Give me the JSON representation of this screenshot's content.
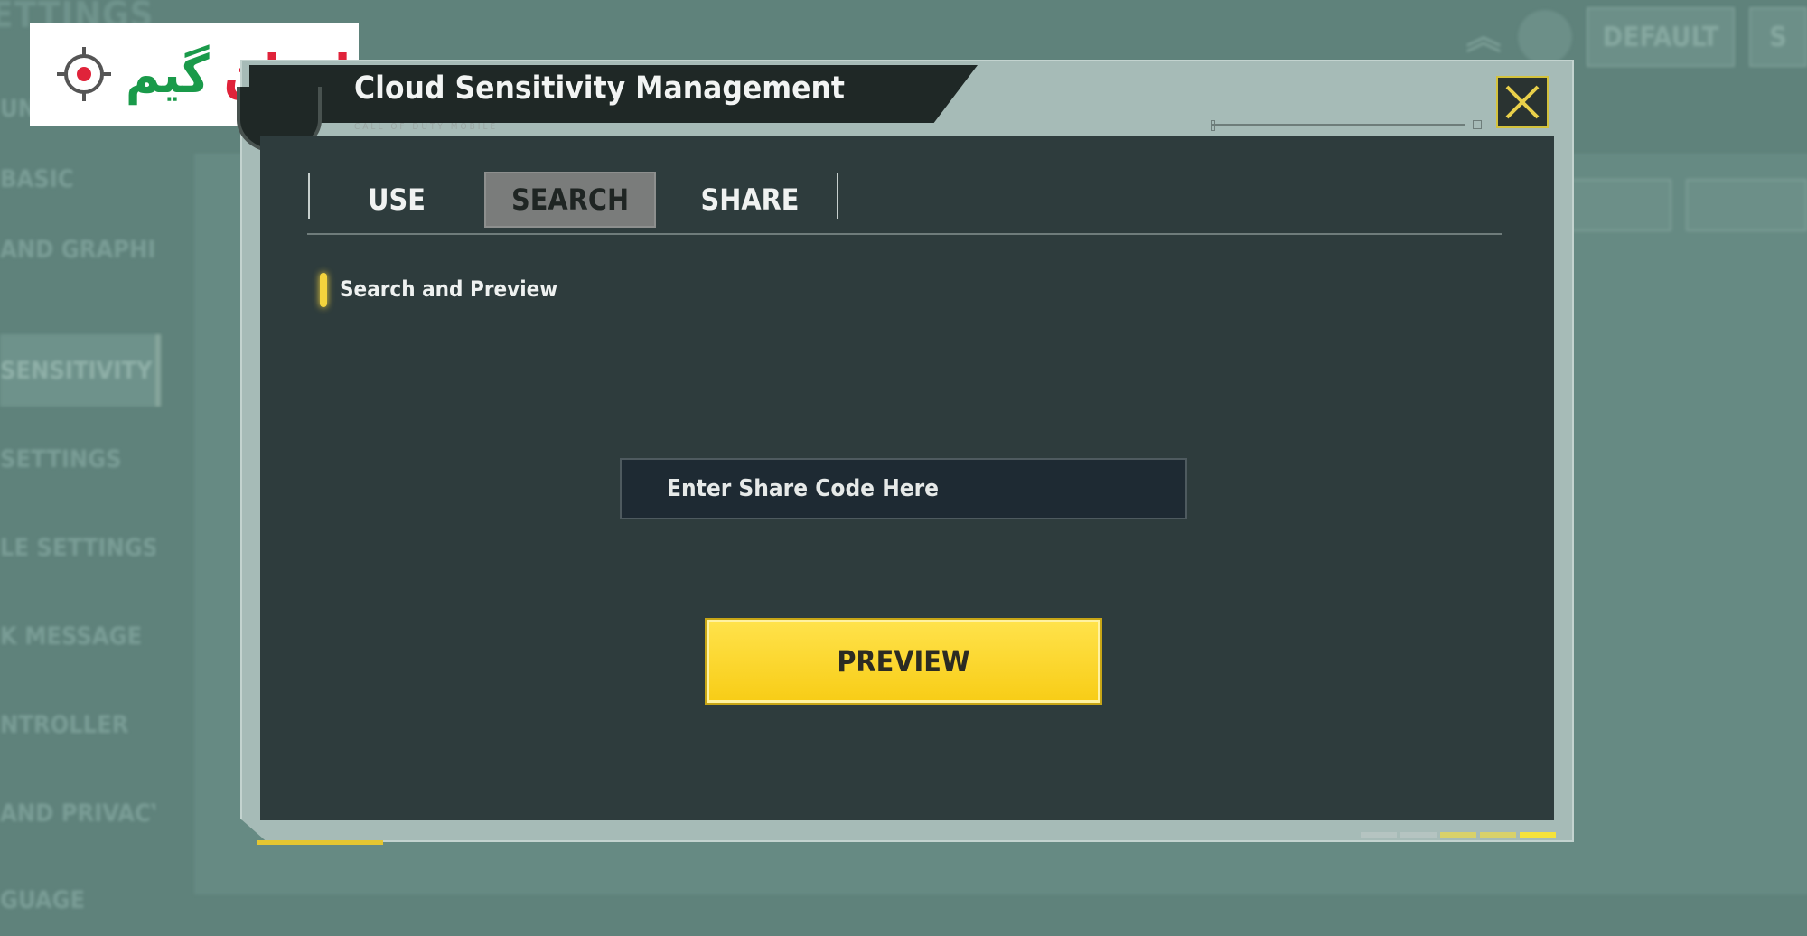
{
  "background": {
    "title": "ETTINGS",
    "sidebar": [
      "UN",
      "BASIC",
      "AND GRAPHICS",
      "SENSITIVITY",
      "SETTINGS",
      "LE SETTINGS",
      "K MESSAGE",
      "NTROLLER",
      "AND PRIVACY",
      "GUAGE"
    ],
    "default_button": "DEFAULT",
    "save_button": "S"
  },
  "logo": {
    "text_part1": "ارزان",
    "text_part2": "گیم"
  },
  "dialog": {
    "title": "Cloud Sensitivity Management",
    "subtitle": "CALL OF DUTY MOBILE",
    "tabs": [
      {
        "label": "USE",
        "selected": false
      },
      {
        "label": "SEARCH",
        "selected": true
      },
      {
        "label": "SHARE",
        "selected": false
      }
    ],
    "section_title": "Search and Preview",
    "share_code": {
      "value": "",
      "placeholder": "Enter Share Code Here"
    },
    "preview_label": "PREVIEW"
  },
  "colors": {
    "accent": "#f8d22a",
    "panel": "#2e3c3d",
    "frame": "#a6bbb7",
    "header": "#1f2826"
  },
  "icons": {
    "close": "close-x-icon",
    "logo": "crosshair-icon"
  },
  "page_indicator": {
    "total": 5,
    "current": 5
  }
}
